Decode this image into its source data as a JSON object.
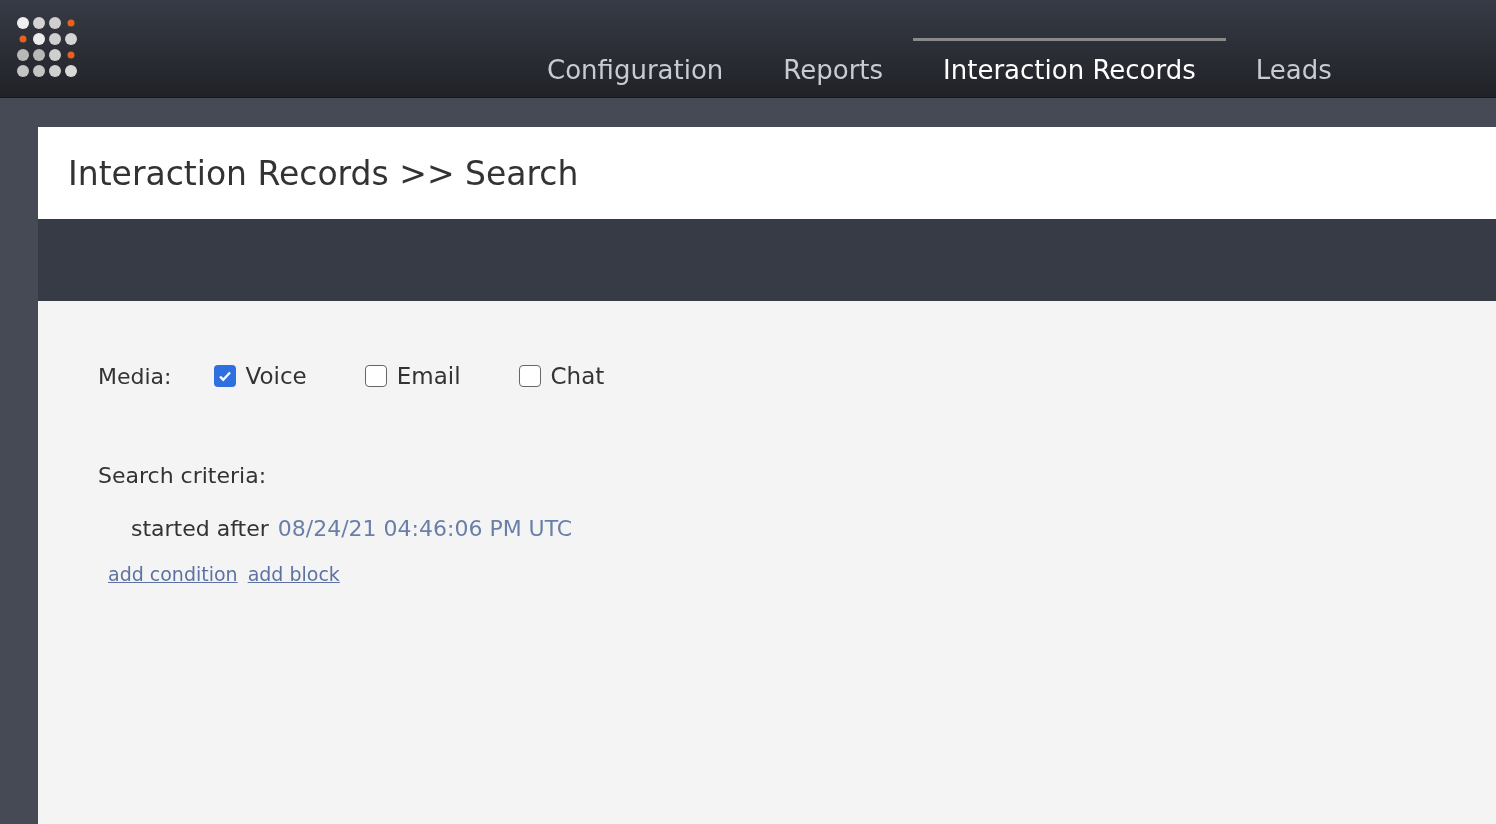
{
  "nav": {
    "tabs": [
      {
        "label": "Configuration",
        "selected": false
      },
      {
        "label": "Reports",
        "selected": false
      },
      {
        "label": "Interaction Records",
        "selected": true
      },
      {
        "label": "Leads",
        "selected": false
      }
    ]
  },
  "page": {
    "title": "Interaction Records >> Search"
  },
  "media": {
    "label": "Media:",
    "options": [
      {
        "label": "Voice",
        "checked": true
      },
      {
        "label": "Email",
        "checked": false
      },
      {
        "label": "Chat",
        "checked": false
      }
    ]
  },
  "criteria": {
    "label": "Search criteria:",
    "conditions": [
      {
        "field": "started after",
        "value": "08/24/21 04:46:06 PM UTC"
      }
    ],
    "links": [
      "add condition",
      "add block"
    ]
  }
}
